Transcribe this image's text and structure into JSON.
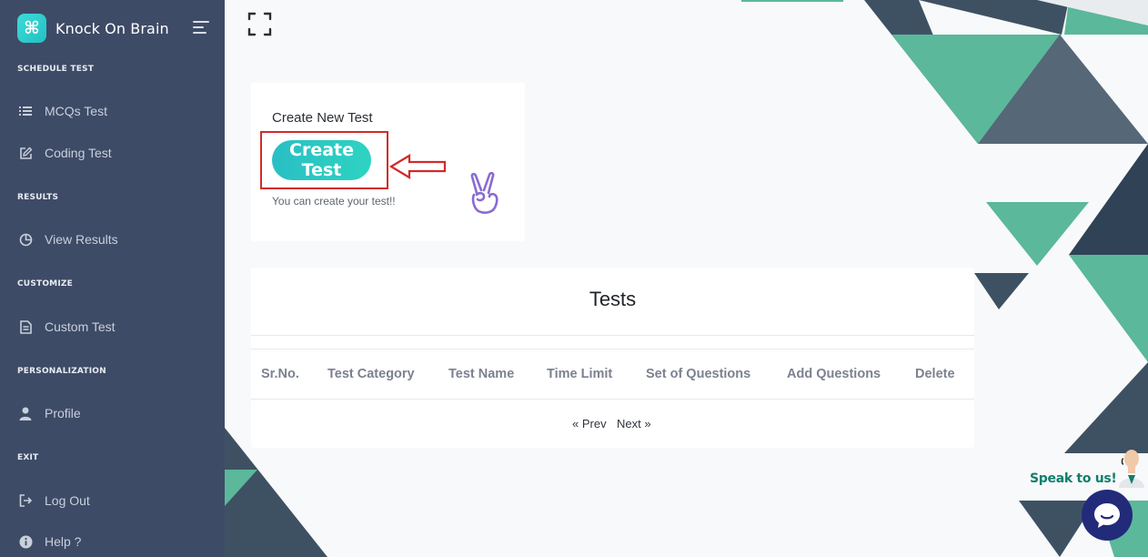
{
  "brand": {
    "name": "Knock On Brain",
    "logo_glyph": "⌘"
  },
  "sidebar": {
    "sections": [
      {
        "title": "SCHEDULE TEST",
        "items": [
          {
            "label": "MCQs Test",
            "icon": "list-icon"
          },
          {
            "label": "Coding Test",
            "icon": "edit-icon"
          }
        ]
      },
      {
        "title": "RESULTS",
        "items": [
          {
            "label": "View Results",
            "icon": "pie-chart-icon"
          }
        ]
      },
      {
        "title": "CUSTOMIZE",
        "items": [
          {
            "label": "Custom Test",
            "icon": "document-icon"
          }
        ]
      },
      {
        "title": "PERSONALIZATION",
        "items": [
          {
            "label": "Profile",
            "icon": "user-icon"
          }
        ]
      },
      {
        "title": "EXIT",
        "items": [
          {
            "label": "Log Out",
            "icon": "logout-icon"
          },
          {
            "label": "Help ?",
            "icon": "info-icon"
          }
        ]
      }
    ]
  },
  "create_card": {
    "title": "Create New Test",
    "button_label": "Create Test",
    "hint": "You can create your test!!"
  },
  "tests_card": {
    "title": "Tests",
    "columns": [
      "Sr.No.",
      "Test Category",
      "Test Name",
      "Time Limit",
      "Set of Questions",
      "Add Questions",
      "Delete"
    ],
    "rows": [],
    "prev_label": "« Prev",
    "next_label": "Next »"
  },
  "chat": {
    "label": "Speak to us!"
  },
  "colors": {
    "sidebar": "#3e4b66",
    "accent": "#2ed3c1",
    "highlight": "#d22a2a",
    "chat": "#222a7a",
    "tri_green": "#5bb89a",
    "tri_slate": "#3e5163"
  }
}
